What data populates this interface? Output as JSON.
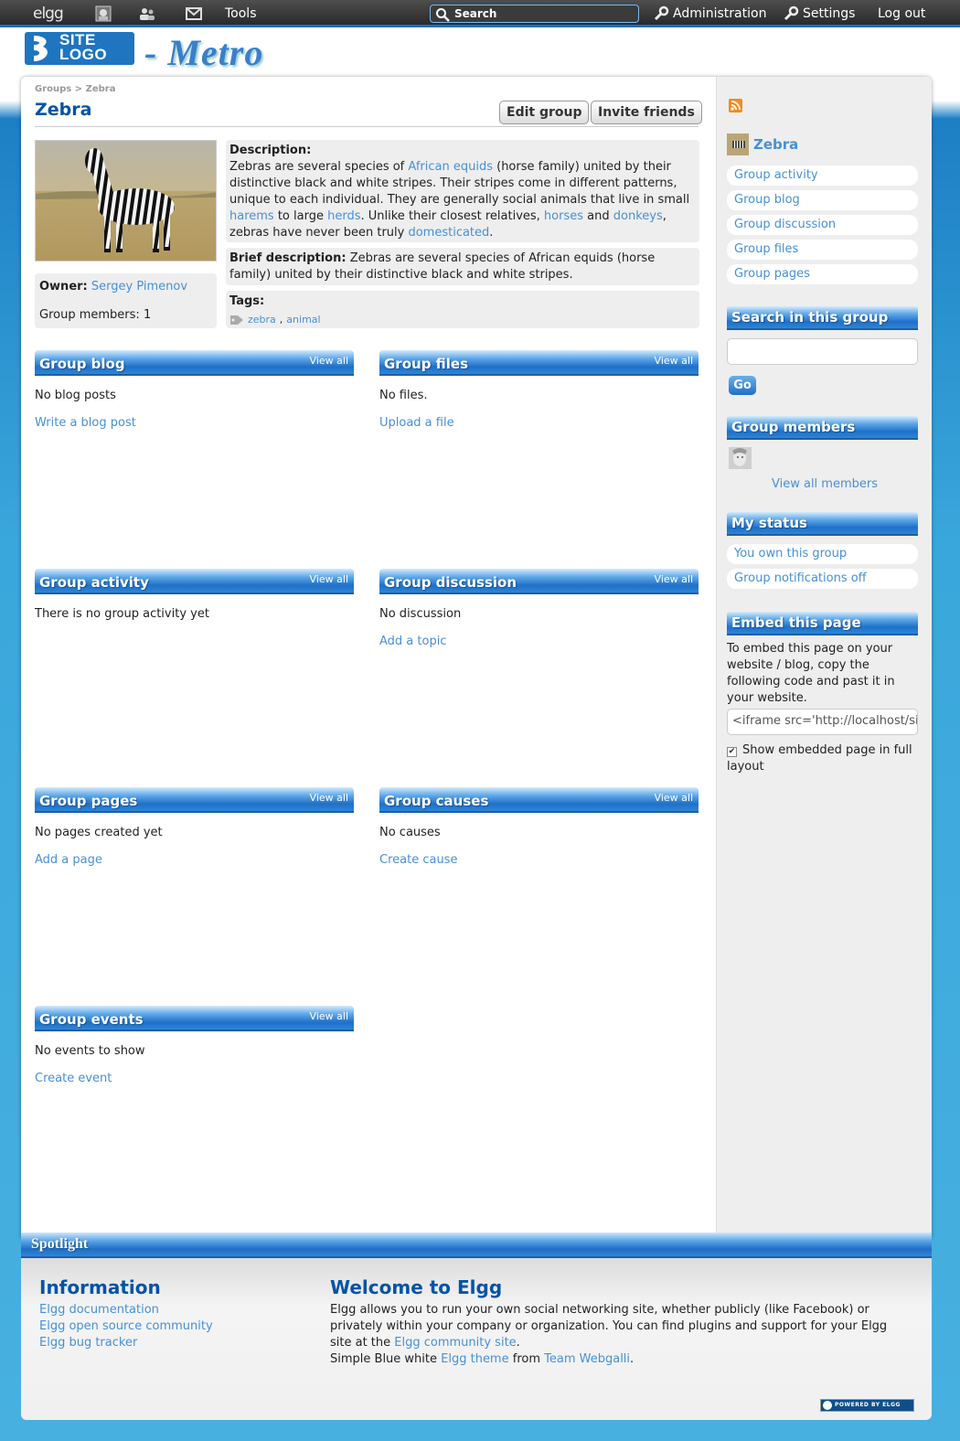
{
  "topbar": {
    "logo": "elgg",
    "tools": "Tools",
    "search_placeholder": "Search",
    "administration": "Administration",
    "settings": "Settings",
    "logout": "Log out"
  },
  "header": {
    "logo_line1": "SITE",
    "logo_line2": "LOGO",
    "site_title": "- Metro"
  },
  "breadcrumb": {
    "parent": "Groups",
    "separator": ">",
    "current": "Zebra"
  },
  "page": {
    "title": "Zebra",
    "edit_button": "Edit group",
    "invite_button": "Invite friends"
  },
  "profile": {
    "owner_label": "Owner:",
    "owner_name": "Sergey Pimenov",
    "members_label": "Group members:",
    "members_count": "1",
    "description_label": "Description:",
    "desc": {
      "t1": "Zebras are several species of ",
      "l1": "African equids",
      "t2": " (horse family) united by their distinctive black and white stripes. Their stripes come in different patterns, unique to each individual. They are generally social animals that live in small ",
      "l2": "harems",
      "t3": " to large ",
      "l3": "herds",
      "t4": ". Unlike their closest relatives, ",
      "l4": "horses",
      "t5": " and ",
      "l5": "donkeys",
      "t6": ", zebras have never been truly ",
      "l6": "domesticated",
      "t7": "."
    },
    "brief_label": "Brief description:",
    "brief_text": "Zebras are several species of African equids (horse family) united by their distinctive black and white stripes.",
    "tags_label": "Tags:",
    "tag1": "zebra",
    "tag_sep": ",",
    "tag2": "animal"
  },
  "widgets": {
    "view_all": "View all",
    "blog": {
      "title": "Group blog",
      "empty": "No blog posts",
      "action": "Write a blog post"
    },
    "files": {
      "title": "Group files",
      "empty": "No files.",
      "action": "Upload a file"
    },
    "activity": {
      "title": "Group activity",
      "empty": "There is no group activity yet"
    },
    "discussion": {
      "title": "Group discussion",
      "empty": "No discussion",
      "action": "Add a topic"
    },
    "pages": {
      "title": "Group pages",
      "empty": "No pages created yet",
      "action": "Add a page"
    },
    "causes": {
      "title": "Group causes",
      "empty": "No causes",
      "action": "Create cause"
    },
    "events": {
      "title": "Group events",
      "empty": "No events to show",
      "action": "Create event"
    }
  },
  "sidebar": {
    "group_name": "Zebra",
    "menu": [
      "Group activity",
      "Group blog",
      "Group discussion",
      "Group files",
      "Group pages"
    ],
    "search_title": "Search in this group",
    "go_button": "Go",
    "members_title": "Group members",
    "view_all_members": "View all members",
    "status_title": "My status",
    "status_items": [
      "You own this group",
      "Group notifications off"
    ],
    "embed_title": "Embed this page",
    "embed_text": "To embed this page on your website / blog, copy the following code and past it in your website.",
    "embed_code": "<iframe src='http://localhost/sit",
    "embed_checkbox_label": "Show embedded page in full layout"
  },
  "footer": {
    "spotlight": "Spotlight",
    "info_title": "Information",
    "info_links": [
      "Elgg documentation",
      "Elgg open source community",
      "Elgg bug tracker"
    ],
    "welcome_title": "Welcome to Elgg",
    "w1": "Elgg allows you to run your own social networking site, whether publicly (like Facebook) or privately within your company or organization. You can find plugins and support for your Elgg site at the ",
    "w_link1": "Elgg community site",
    "w2": ".",
    "w3": "Simple Blue white ",
    "w_link2": "Elgg theme",
    "w4": " from ",
    "w_link3": "Team Webgalli",
    "w5": ".",
    "powered": "POWERED BY ELGG"
  },
  "colors": {
    "accent": "#4690d6",
    "title_blue": "#0054a7",
    "bar_blue": "#1f70c8"
  }
}
